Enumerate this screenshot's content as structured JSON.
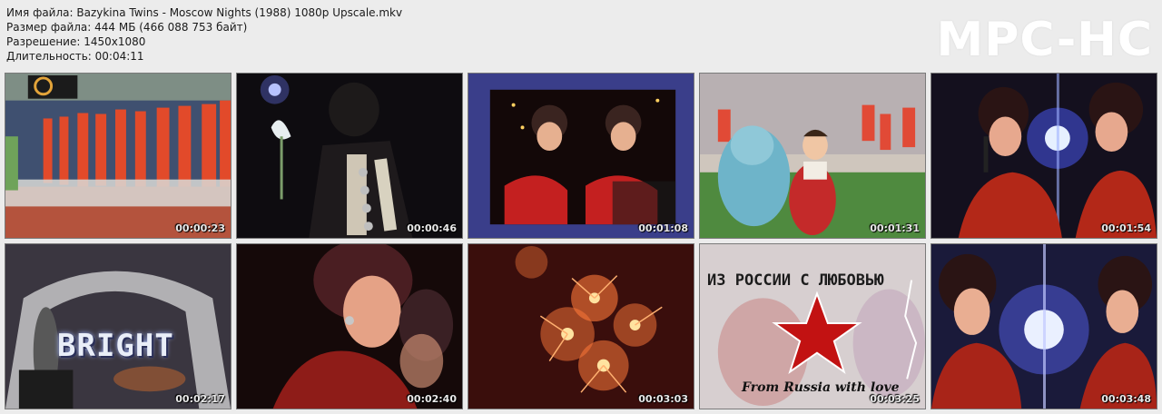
{
  "info": {
    "filename": "Имя файла: Bazykina Twins - Moscow Nights (1988) 1080p Upscale.mkv",
    "filesize": "Размер файла: 444 МБ (466 088 753 байт)",
    "resolution": "Разрешение: 1450x1080",
    "duration": "Длительность: 00:04:11"
  },
  "logo": "MPC-HC",
  "thumbnails": [
    {
      "timestamp": "00:00:23"
    },
    {
      "timestamp": "00:00:46"
    },
    {
      "timestamp": "00:01:08"
    },
    {
      "timestamp": "00:01:31"
    },
    {
      "timestamp": "00:01:54"
    },
    {
      "timestamp": "00:02:17",
      "caption": "BRIGHT"
    },
    {
      "timestamp": "00:02:40"
    },
    {
      "timestamp": "00:03:03"
    },
    {
      "timestamp": "00:03:25",
      "caption_ru": "ИЗ РОССИИ С ЛЮБОВЬЮ",
      "caption_en": "From Russia with love"
    },
    {
      "timestamp": "00:03:48"
    }
  ]
}
